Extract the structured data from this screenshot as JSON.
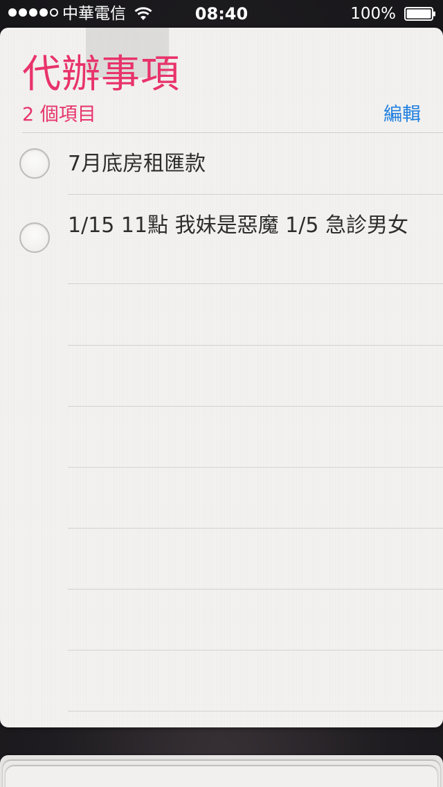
{
  "status_bar": {
    "carrier": "中華電信",
    "time": "08:40",
    "battery_percent": "100%"
  },
  "list": {
    "title": "代辦事項",
    "count_label": "2 個項目",
    "edit_label": "編輯",
    "items": [
      {
        "text": "7月底房租匯款",
        "completed": false
      },
      {
        "text": "1/15 11點 我妹是惡魔 1/5 急診男女",
        "completed": false
      }
    ]
  },
  "colors": {
    "accent": "#e8336b",
    "link": "#1f7fe0",
    "paper": "#f3f2f0"
  },
  "icons": [
    "signal-dots-icon",
    "wifi-icon",
    "battery-icon",
    "checkbox-circle-icon"
  ]
}
